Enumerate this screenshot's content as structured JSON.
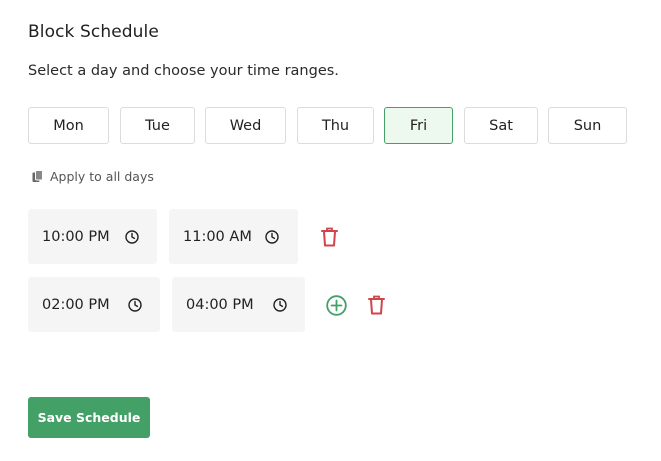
{
  "header": {
    "title": "Block Schedule",
    "subtitle": "Select a day and choose your time ranges."
  },
  "days": [
    {
      "label": "Mon",
      "selected": false
    },
    {
      "label": "Tue",
      "selected": false
    },
    {
      "label": "Wed",
      "selected": false
    },
    {
      "label": "Thu",
      "selected": false
    },
    {
      "label": "Fri",
      "selected": true
    },
    {
      "label": "Sat",
      "selected": false
    },
    {
      "label": "Sun",
      "selected": false
    }
  ],
  "apply_all": {
    "label": "Apply to all days",
    "icon": "copy-icon"
  },
  "time_ranges": [
    {
      "start": "10:00 PM",
      "end": "11:00 AM"
    },
    {
      "start": "02:00 PM",
      "end": "04:00 PM"
    }
  ],
  "icons": {
    "clock": "clock-icon",
    "delete": "trash-icon",
    "add": "plus-circle-icon"
  },
  "colors": {
    "accent": "#43a066",
    "selected_bg": "#edf8ef",
    "delete": "#d0454a",
    "input_bg": "#f5f5f5"
  },
  "footer": {
    "save_label": "Save Schedule"
  }
}
